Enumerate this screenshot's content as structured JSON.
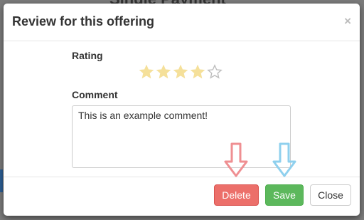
{
  "background": {
    "heading": "Single Payment"
  },
  "modal": {
    "title": "Review for this offering",
    "close_symbol": "×",
    "rating_label": "Rating",
    "rating": {
      "value": 4,
      "max": 5,
      "filled_color": "#f5e09a",
      "empty_color": "#bdbdbd"
    },
    "comment_label": "Comment",
    "comment_value": "This is an example comment!",
    "buttons": {
      "delete": "Delete",
      "save": "Save",
      "close": "Close"
    }
  },
  "annotations": {
    "delete_arrow_color": "#ef8f92",
    "save_arrow_color": "#8fd0ee"
  }
}
